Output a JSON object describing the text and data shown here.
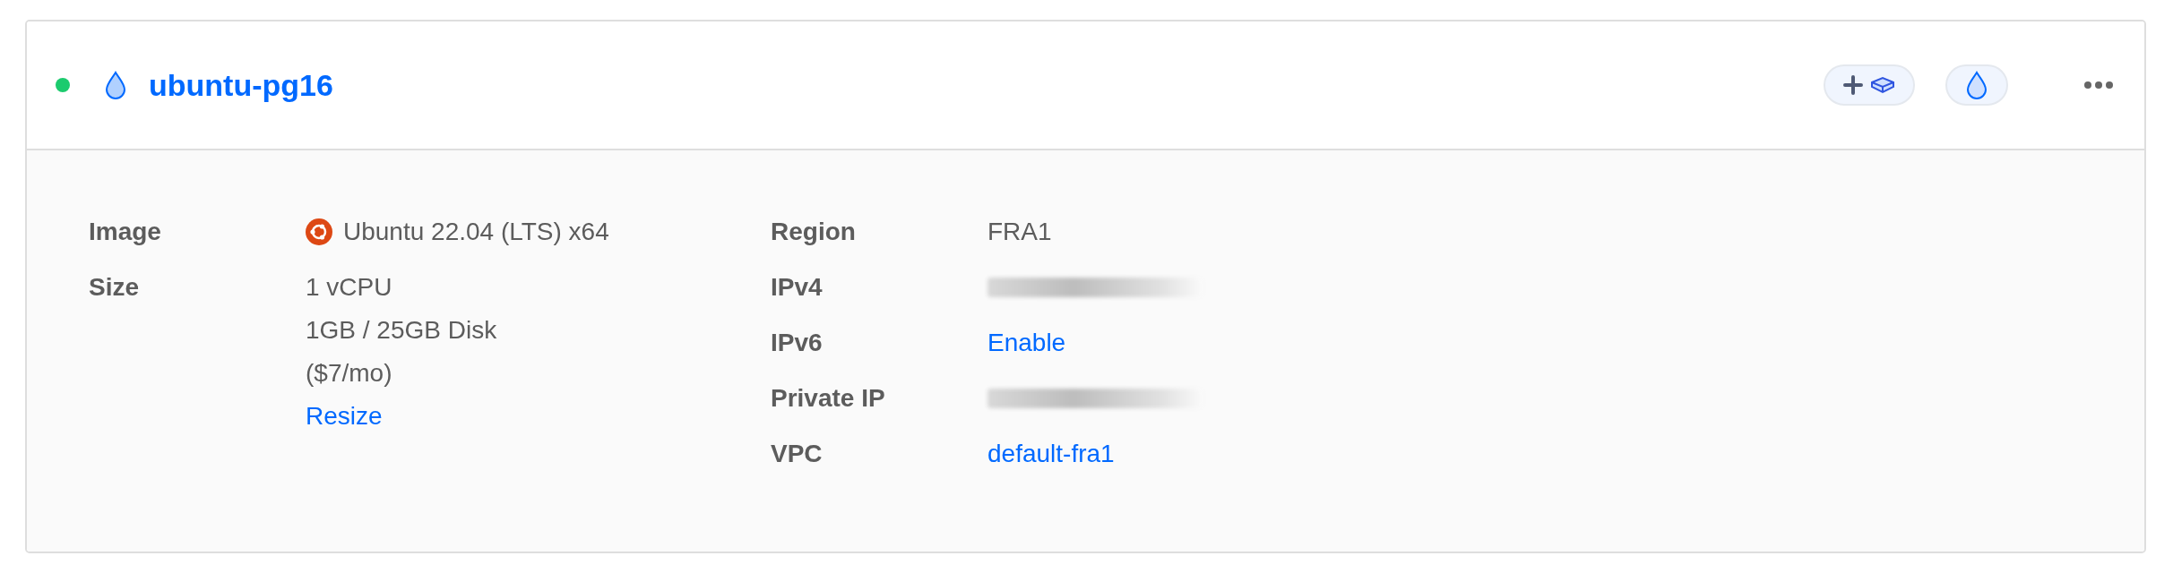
{
  "droplet": {
    "running": true,
    "name": "ubuntu-pg16"
  },
  "details": [
    [
      {
        "label": "Image",
        "values": [
          {
            "kind": "os",
            "text": "Ubuntu 22.04 (LTS) x64"
          }
        ]
      },
      {
        "label": "Size",
        "values": [
          {
            "kind": "text",
            "text": "1 vCPU"
          },
          {
            "kind": "text",
            "text": "1GB / 25GB Disk"
          },
          {
            "kind": "text",
            "text": "($7/mo)"
          },
          {
            "kind": "link",
            "text": "Resize"
          }
        ]
      }
    ],
    [
      {
        "label": "Region",
        "values": [
          {
            "kind": "text",
            "text": "FRA1"
          }
        ]
      },
      {
        "label": "IPv4",
        "values": [
          {
            "kind": "redacted"
          }
        ]
      },
      {
        "label": "IPv6",
        "values": [
          {
            "kind": "link",
            "text": "Enable"
          }
        ]
      },
      {
        "label": "Private IP",
        "values": [
          {
            "kind": "redacted"
          }
        ]
      },
      {
        "label": "VPC",
        "values": [
          {
            "kind": "link",
            "text": "default-fra1"
          }
        ]
      }
    ]
  ]
}
